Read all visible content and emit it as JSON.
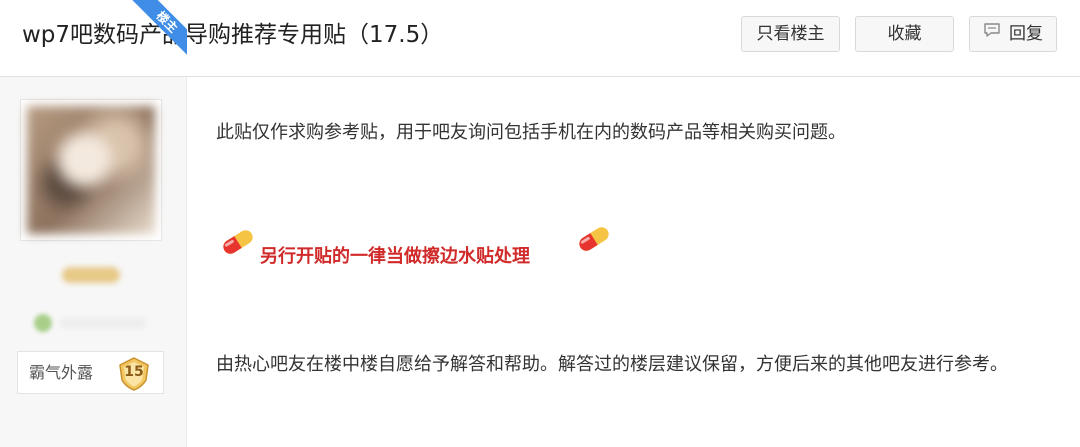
{
  "thread": {
    "title": "wp7吧数码产品导购推荐专用贴（17.5）"
  },
  "actions": {
    "only_op_label": "只看楼主",
    "favorite_label": "收藏",
    "reply_label": "回复"
  },
  "author": {
    "badge_label": "楼主",
    "honor_title": "霸气外露",
    "level": "15"
  },
  "post": {
    "paragraph1": "此贴仅作求购参考贴，用于吧友询问包括手机在内的数码产品等相关购买问题。",
    "highlight": "另行开贴的一律当做擦边水贴处理",
    "paragraph3": "由热心吧友在楼中楼自愿给予解答和帮助。解答过的楼层建议保留，方便后来的其他吧友进行参考。"
  },
  "colors": {
    "highlight_red": "#d02a2a",
    "badge_blue": "#3f8de6",
    "pill_red": "#e8342e",
    "pill_yellow": "#f6c445"
  },
  "icons": {
    "reply": "speech-bubble-icon",
    "pill": "pill-capsule-icon",
    "level": "shield-badge-icon"
  }
}
